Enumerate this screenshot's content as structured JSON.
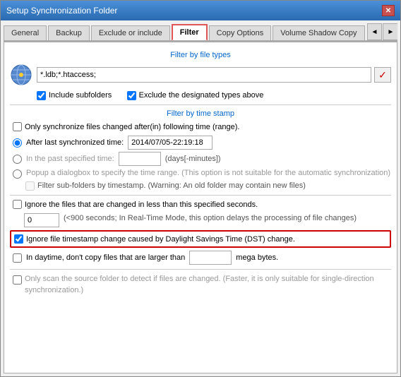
{
  "window": {
    "title": "Setup Synchronization Folder",
    "close_btn": "✕"
  },
  "tabs": [
    {
      "label": "General",
      "active": false
    },
    {
      "label": "Backup",
      "active": false
    },
    {
      "label": "Exclude or include",
      "active": false
    },
    {
      "label": "Filter",
      "active": true
    },
    {
      "label": "Copy Options",
      "active": false
    },
    {
      "label": "Volume Shadow Copy",
      "active": false
    }
  ],
  "tab_scroll_prev": "◄",
  "tab_scroll_next": "►",
  "filter_by_file_types_header": "Filter by file types",
  "filter_input_value": "*.ldb;*.htaccess;",
  "checkmark_symbol": "✓",
  "include_subfolders_label": "Include subfolders",
  "exclude_designated_label": "Exclude the designated types above",
  "filter_by_timestamp_header": "Filter by time stamp",
  "only_sync_changed_label": "Only synchronize files changed after(in) following time (range).",
  "after_last_sync_label": "After last synchronized time:",
  "after_last_sync_value": "2014/07/05-22:19:18",
  "in_past_label": "In the past specified time:",
  "days_placeholder": "",
  "days_minutes_label": "(days[-minutes])",
  "popup_dialog_label": "Popup a dialogbox to specify the time range. (This option is not suitable for the automatic synchronization)",
  "filter_subfolders_label": "Filter sub-folders by timestamp. (Warning: An old folder may contain new files)",
  "ignore_less_seconds_label": "Ignore the files that are changed in less than this specified seconds.",
  "seconds_value": "0",
  "seconds_note": "(<900 seconds; In Real-Time Mode, this option delays the processing of file changes)",
  "dst_label": "Ignore file timestamp change caused by Daylight Savings Time (DST) change.",
  "daytime_label": "In daytime, don't copy files that are larger than",
  "mega_placeholder": "",
  "mega_bytes_label": "mega bytes.",
  "only_scan_label": "Only scan the source folder to detect if files are changed. (Faster, it is only suitable for single-direction synchronization.)"
}
